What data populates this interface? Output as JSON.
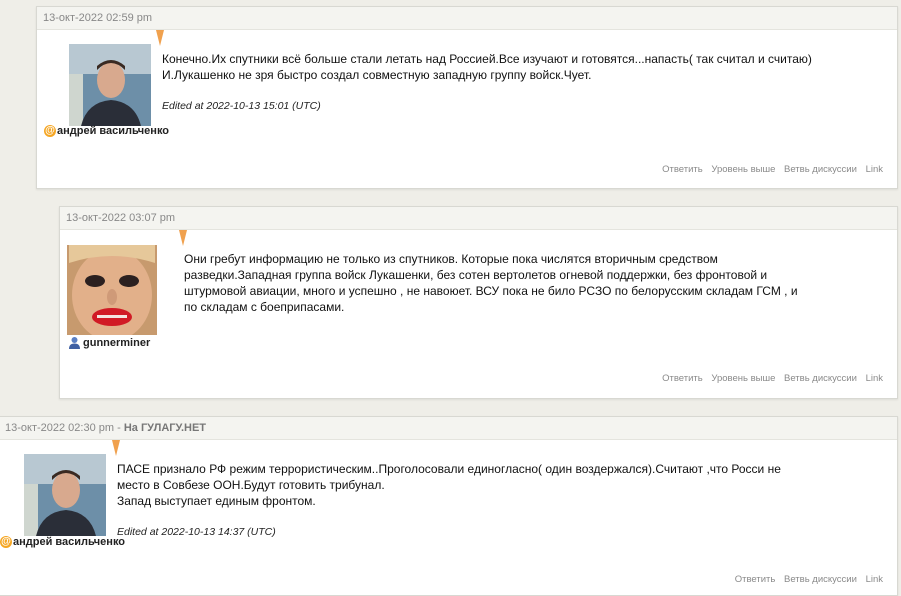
{
  "comments": [
    {
      "date": "13-окт-2022 02:59 pm",
      "author": "андрей васильченко",
      "lines": [
        "Конечно.Их спутники всё больше стали летать над Россией.Все изучают и готовятся...напасть( так считал и считаю)",
        "И.Лукашенко не зря быстро создал совместную западную группу войск.Чует."
      ],
      "edited": "Edited at 2022-10-13 15:01 (UTC)",
      "actions": [
        "Ответить",
        "Уровень выше",
        "Ветвь дискуссии",
        "Link"
      ]
    },
    {
      "date": "13-окт-2022 03:07 pm",
      "author": "gunnerminer",
      "lines": [
        "Они гребут информацию не только из спутников. Которые пока числятся вторичным средством",
        "разведки.Западная группа войск Лукашенки, без сотен вертолетов огневой поддержки, без фронтовой и",
        "штурмовой авиации, много и успешно , не навоюет. ВСУ пока не било РСЗО по белорусским складам ГСМ , и",
        "по складам с боеприпасами."
      ],
      "actions": [
        "Ответить",
        "Уровень выше",
        "Ветвь дискуссии",
        "Link"
      ]
    },
    {
      "date": "13-окт-2022 02:30 pm",
      "topic": "На ГУЛАГУ.НЕТ",
      "author": "андрей васильченко",
      "lines": [
        "ПАСЕ признало РФ режим террористическим..Проголосовали единогласно( один воздержался).Считают ,что Росси не",
        "место в Совбезе ООН.Будут готовить трибунал.",
        "Запад выступает единым фронтом."
      ],
      "edited": "Edited at 2022-10-13 14:37 (UTC)",
      "actions": [
        "Ответить",
        "Ветвь дискуссии",
        "Link"
      ]
    }
  ],
  "date_topic_separator": " - "
}
